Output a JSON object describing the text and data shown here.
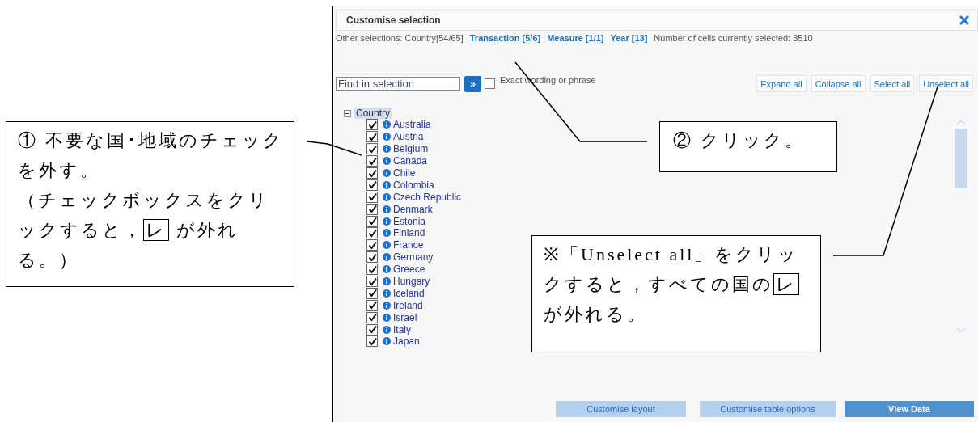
{
  "dialog": {
    "title": "Customise selection",
    "other_selections": {
      "label": "Other selections: Country[54/65]",
      "links": [
        "Transaction [5/6]",
        "Measure [1/1]",
        "Year [13]"
      ],
      "cells": "Number of cells currently selected: 3510"
    },
    "search": {
      "placeholder": "Find in selection",
      "go": "»",
      "exact": {
        "label": "Exact wording or phrase",
        "checked": false
      }
    },
    "actions": [
      "Expand all",
      "Collapse all",
      "Select all",
      "Unselect all"
    ],
    "tree": {
      "label": "Country",
      "expanded": true,
      "selected": true,
      "children": [
        {
          "label": "Australia",
          "checked": true
        },
        {
          "label": "Austria",
          "checked": true
        },
        {
          "label": "Belgium",
          "checked": true
        },
        {
          "label": "Canada",
          "checked": true
        },
        {
          "label": "Chile",
          "checked": true
        },
        {
          "label": "Colombia",
          "checked": true
        },
        {
          "label": "Czech Republic",
          "checked": true
        },
        {
          "label": "Denmark",
          "checked": true
        },
        {
          "label": "Estonia",
          "checked": true
        },
        {
          "label": "Finland",
          "checked": true
        },
        {
          "label": "France",
          "checked": true
        },
        {
          "label": "Germany",
          "checked": true
        },
        {
          "label": "Greece",
          "checked": true
        },
        {
          "label": "Hungary",
          "checked": true
        },
        {
          "label": "Iceland",
          "checked": true
        },
        {
          "label": "Ireland",
          "checked": true
        },
        {
          "label": "Israel",
          "checked": true
        },
        {
          "label": "Italy",
          "checked": true
        },
        {
          "label": "Japan",
          "checked": true
        }
      ]
    },
    "footer_buttons": [
      {
        "label": "Customise layout",
        "kind": "secondary"
      },
      {
        "label": "Customise table options",
        "kind": "secondary"
      },
      {
        "label": "View Data",
        "kind": "primary"
      }
    ]
  },
  "callouts": [
    {
      "paragraphs": [
        [
          {
            "text": "① 不要な国･地域のチェックを外す。"
          }
        ],
        [
          {
            "text": "（チェックボックスをクリックすると，"
          },
          {
            "text": "レ",
            "boxed": true
          },
          {
            "text": " が外れる。）"
          }
        ]
      ]
    },
    {
      "paragraphs": [
        [
          {
            "text": "② クリック。"
          }
        ]
      ]
    },
    {
      "paragraphs": [
        [
          {
            "text": "※「Unselect all」をクリックすると，すべての国の"
          },
          {
            "text": "レ",
            "boxed": true
          },
          {
            "text": "が外れる。"
          }
        ]
      ]
    }
  ]
}
